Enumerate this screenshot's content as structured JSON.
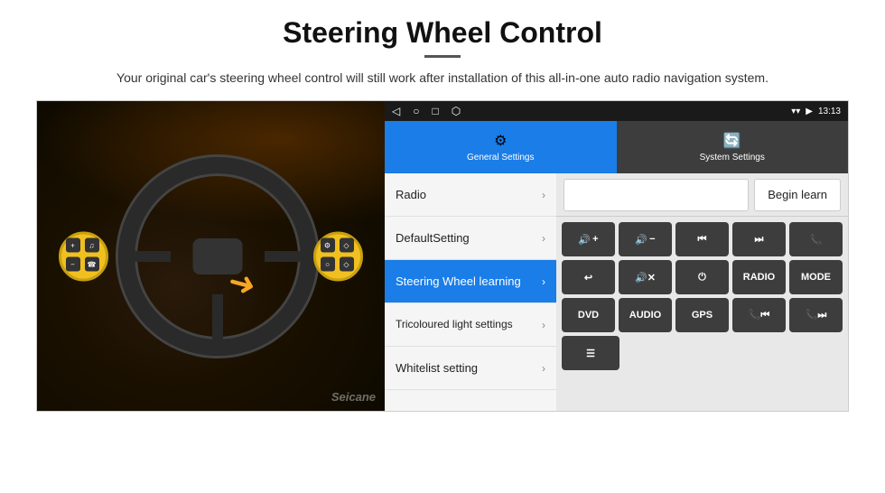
{
  "header": {
    "title": "Steering Wheel Control",
    "subtitle": "Your original car's steering wheel control will still work after installation of this all-in-one auto radio navigation system."
  },
  "android": {
    "status_bar": {
      "time": "13:13",
      "nav_icons": [
        "◁",
        "○",
        "□",
        "⬡"
      ]
    },
    "tabs": [
      {
        "label": "General Settings",
        "icon": "⚙",
        "active": true
      },
      {
        "label": "System Settings",
        "icon": "🔄",
        "active": false
      }
    ],
    "menu": [
      {
        "label": "Radio",
        "active": false
      },
      {
        "label": "DefaultSetting",
        "active": false
      },
      {
        "label": "Steering Wheel learning",
        "active": true
      },
      {
        "label": "Tricoloured light settings",
        "active": false
      },
      {
        "label": "Whitelist setting",
        "active": false
      }
    ],
    "right_panel": {
      "begin_learn_label": "Begin learn",
      "button_rows": [
        [
          {
            "label": "🔊+",
            "key": "vol-up"
          },
          {
            "label": "🔊-",
            "key": "vol-down"
          },
          {
            "label": "⏮",
            "key": "prev"
          },
          {
            "label": "⏭",
            "key": "next"
          },
          {
            "label": "📞",
            "key": "phone"
          }
        ],
        [
          {
            "label": "↩",
            "key": "back"
          },
          {
            "label": "🔊✕",
            "key": "mute"
          },
          {
            "label": "⏻",
            "key": "power"
          },
          {
            "label": "RADIO",
            "key": "radio"
          },
          {
            "label": "MODE",
            "key": "mode"
          }
        ],
        [
          {
            "label": "DVD",
            "key": "dvd"
          },
          {
            "label": "AUDIO",
            "key": "audio"
          },
          {
            "label": "GPS",
            "key": "gps"
          },
          {
            "label": "📞⏮",
            "key": "tel-prev"
          },
          {
            "label": "📞⏭",
            "key": "tel-next"
          }
        ],
        [
          {
            "label": "☰",
            "key": "menu"
          }
        ]
      ]
    }
  },
  "watermark": "Seicane"
}
